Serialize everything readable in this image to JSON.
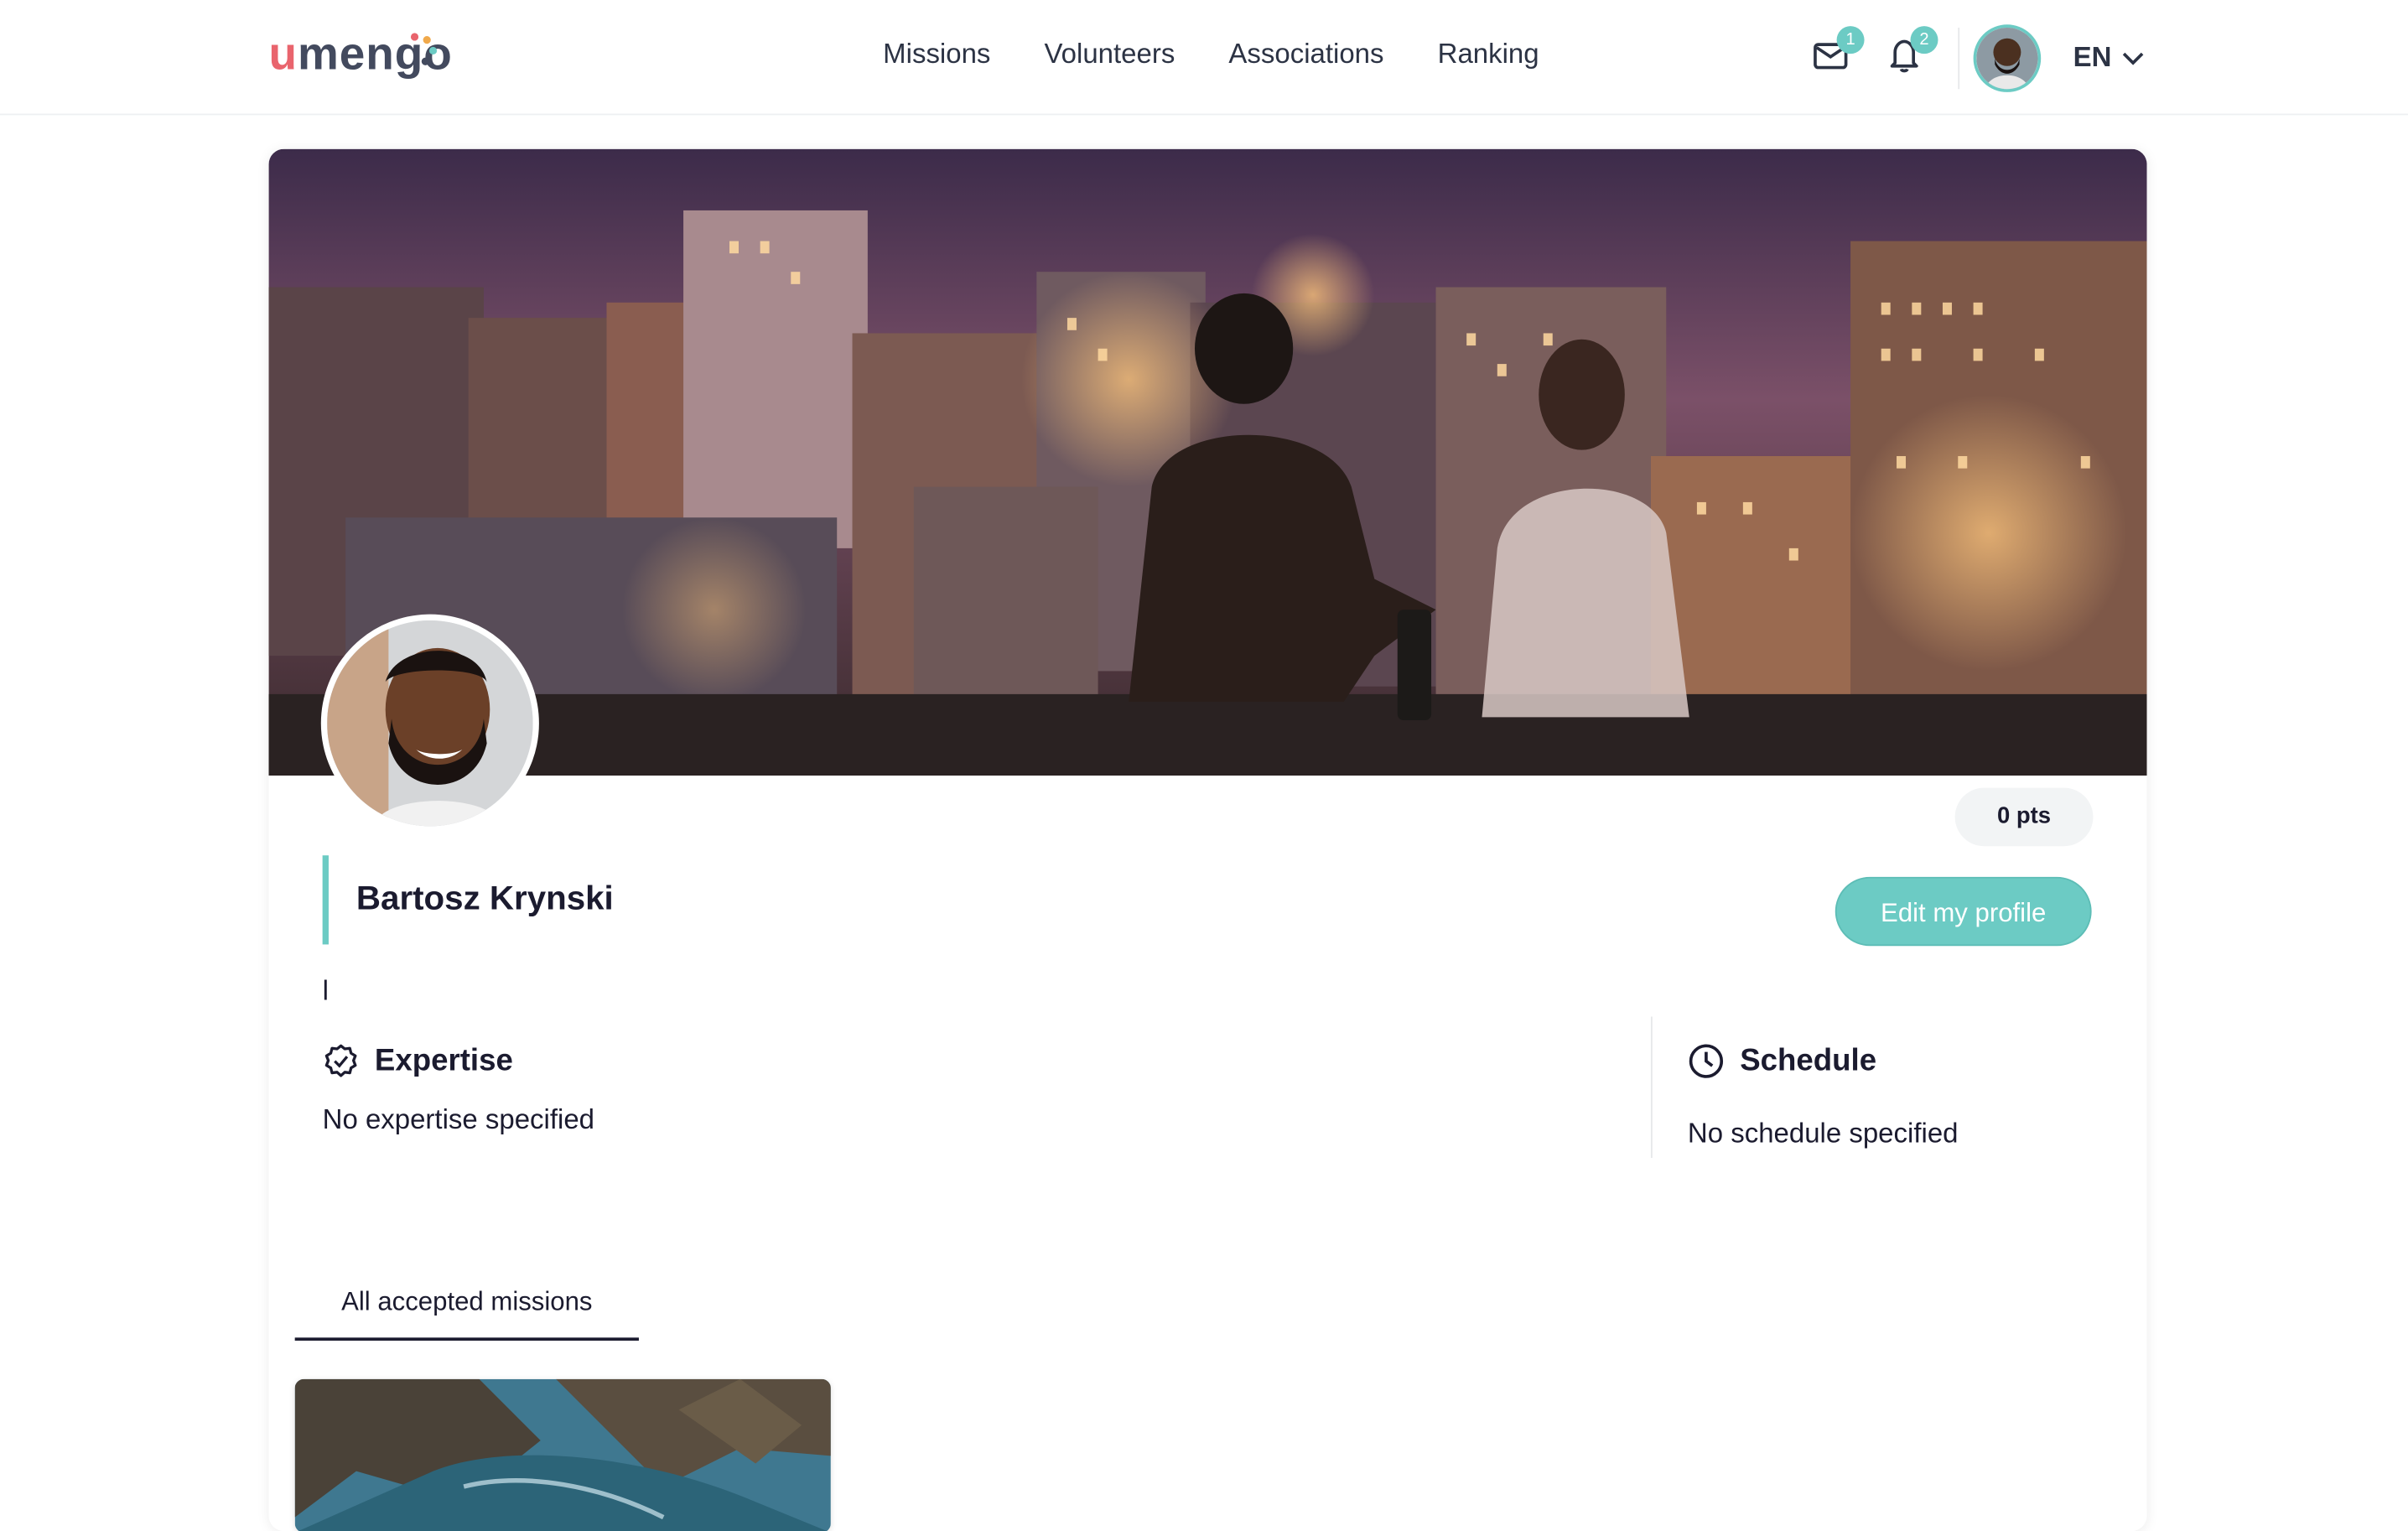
{
  "brand": {
    "logo_left": "u",
    "logo_right": "mengo",
    "accent_color": "#6ccbc4",
    "logo_color": "#e9646d"
  },
  "nav": {
    "items": [
      {
        "label": "Missions"
      },
      {
        "label": "Volunteers"
      },
      {
        "label": "Associations"
      },
      {
        "label": "Ranking"
      }
    ]
  },
  "header": {
    "messages_count": "1",
    "notifications_count": "2",
    "language": "EN",
    "icons": {
      "messages": "envelope-icon",
      "notifications": "bell-icon",
      "language_caret": "chevron-down-icon"
    }
  },
  "profile": {
    "name": "Bartosz Krynski",
    "points": "0 pts",
    "edit_label": "Edit my profile",
    "bio": "l"
  },
  "expertise": {
    "title": "Expertise",
    "text": "No expertise specified",
    "icon": "badge-check-icon"
  },
  "schedule": {
    "title": "Schedule",
    "text": "No schedule specified",
    "icon": "clock-icon"
  },
  "tabs": [
    {
      "label": "All accepted missions",
      "active": true
    }
  ]
}
